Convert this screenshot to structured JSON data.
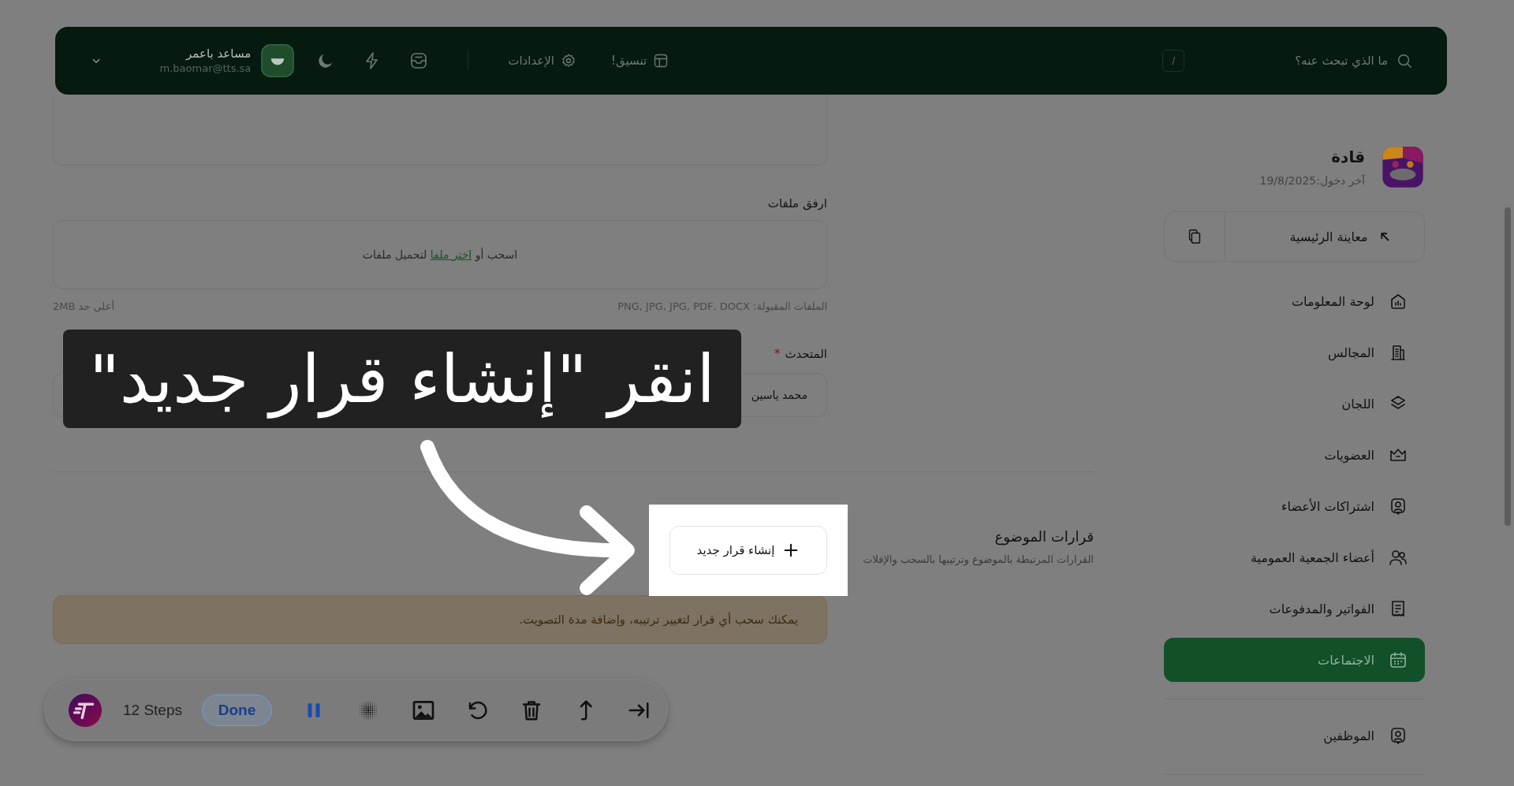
{
  "top_bar": {
    "search": {
      "placeholder": "ما الذي تبحث عنه؟"
    },
    "shortcut_key": "/",
    "links": [
      {
        "label": "تنسيق!"
      },
      {
        "label": "الإعدادات"
      }
    ],
    "user": {
      "name": "مساعد باعمر",
      "email": "m.baomar@tts.sa"
    }
  },
  "sidebar": {
    "org_name": "قادة",
    "last_login": "آخر دخول:19/8/2025",
    "preview_button": "معاينة الرئيسية",
    "menu_groups": [
      {
        "items": [
          {
            "label": "لوحة المعلومات",
            "selected": false
          },
          {
            "label": "المجالس",
            "selected": false
          },
          {
            "label": "اللجان",
            "selected": false
          },
          {
            "label": "العضويات",
            "selected": false
          },
          {
            "label": "اشتراكات الأعضاء",
            "selected": false
          },
          {
            "label": "أعضاء الجمعية العمومية",
            "selected": false
          },
          {
            "label": "الفواتير والمدفوعات",
            "selected": false
          },
          {
            "label": "الاجتماعات",
            "selected": true
          }
        ]
      },
      {
        "items": [
          {
            "label": "الموظفين",
            "selected": false
          }
        ]
      }
    ]
  },
  "form": {
    "attachments": {
      "label": "ارفق ملفات",
      "drop_prefix": "اسحب أو",
      "drop_link": "اختر ملفا",
      "drop_suffix": "لتحميل ملفات",
      "accepted_formats": "الملفات المقبولة: PNG, JPG, JPG, PDF, DOCX",
      "max_size": "أعلى حد 2MB"
    },
    "speaker": {
      "label": "المتحدث",
      "required_mark": "*",
      "value": "محمد ياسين"
    }
  },
  "decisions": {
    "title": "قرارات الموضوع",
    "subtitle": "القرارات المرتبطة بالموضوع وترتيبها بالسحب والإفلات",
    "create_button": "إنشاء قرار جديد",
    "notice": "يمكنك سحب أي قرار لتغيير ترتيبه، وإضافة مدة التصويت."
  },
  "tutorial_overlay": {
    "caption": "انقر \"إنشاء قرار جديد\""
  },
  "recorder_toolbar": {
    "steps": "12 Steps",
    "done_button": "Done"
  }
}
